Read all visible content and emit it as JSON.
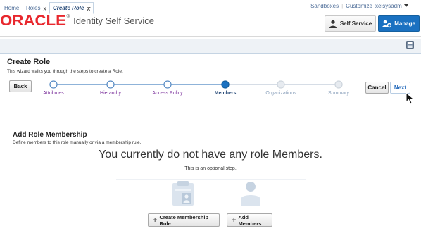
{
  "header": {
    "util_links": {
      "sandboxes": "Sandboxes",
      "customize": "Customize",
      "user": "xelsysadm",
      "more": "···"
    },
    "logo_text": "ORACLE",
    "logo_mark": "®",
    "app_title": "Identity Self Service",
    "buttons": {
      "self_service": "Self Service",
      "manage": "Manage"
    }
  },
  "tabs": {
    "home": "Home",
    "roles": "Roles",
    "create_role": "Create Role",
    "close_glyph": "x"
  },
  "page": {
    "title": "Create Role",
    "description": "This wizard walks you through the steps to create a Role."
  },
  "wizard": {
    "back": "Back",
    "cancel": "Cancel",
    "next": "Next",
    "steps": [
      {
        "label": "Attributes",
        "state": "visited"
      },
      {
        "label": "Hierarchy",
        "state": "visited"
      },
      {
        "label": "Access Policy",
        "state": "visited"
      },
      {
        "label": "Members",
        "state": "current"
      },
      {
        "label": "Organizations",
        "state": "disabled"
      },
      {
        "label": "Summary",
        "state": "disabled"
      }
    ]
  },
  "membership": {
    "title": "Add Role Membership",
    "description": "Define members to this role manually or via a membership rule.",
    "empty_message": "You currently do not have any role Members.",
    "optional_message": "This is an optional step.",
    "create_rule_button": "Create Membership Rule",
    "add_members_button": "Add Members"
  },
  "icons": {
    "self_service": "person-icon",
    "manage": "manage-icon",
    "save": "save-icon",
    "rule": "membership-rule-icon",
    "members": "member-icon",
    "add": "plus-icon",
    "cursor": "mouse-pointer-icon"
  },
  "colors": {
    "oracle_red": "#e8282e",
    "manage_blue": "#1a71c1",
    "link_blue": "#4a6a96",
    "visited_purple": "#7a2f9b"
  }
}
